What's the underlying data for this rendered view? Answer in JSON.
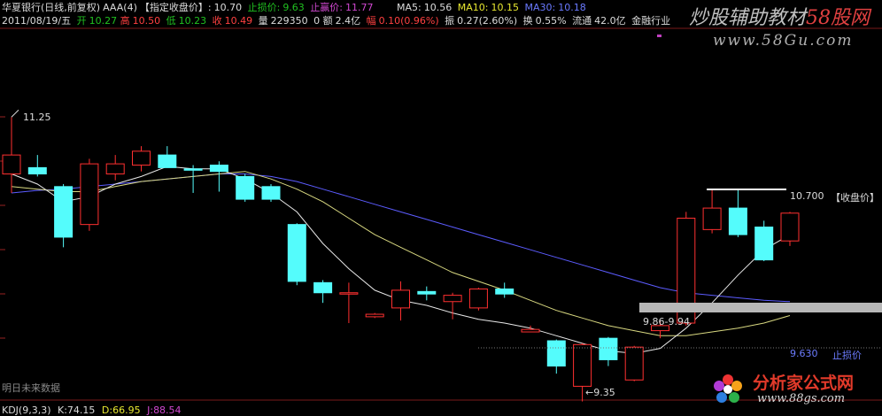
{
  "header": {
    "stock_name": "华夏银行(日线,前复权)",
    "formula": "AAA(4)",
    "close_label": "【指定收盘价】:",
    "close_value": "10.70",
    "stop_loss_label": "止损价:",
    "stop_loss_value": "9.63",
    "stop_profit_label": "止赢价:",
    "stop_profit_value": "11.77",
    "ma5_label": "MA5:",
    "ma5_value": "10.56",
    "ma10_label": "MA10:",
    "ma10_value": "10.15",
    "ma30_label": "MA30:",
    "ma30_value": "10.18"
  },
  "quote": {
    "date": "2011/08/19/五",
    "open_label": "开",
    "open": "10.27",
    "high_label": "高",
    "high": "10.50",
    "low_label": "低",
    "low": "10.23",
    "close_label": "收",
    "close": "10.49",
    "volume_label": "量",
    "volume": "229350",
    "amount_label": "0 额",
    "amount": "2.4亿",
    "change_label": "幅",
    "change": "0.10(0.96%)",
    "amplitude_label": "振",
    "amplitude": "0.27(2.60%)",
    "turnover_label": "换",
    "turnover": "0.55%",
    "float_label": "流通",
    "float_value": "42.0亿",
    "industry": "金融行业"
  },
  "watermark": {
    "top_text": "炒股辅助教材",
    "top_brand": "58股网",
    "top_url": "www.58Gu.com",
    "bottom_text": "分析家公式网",
    "bottom_url": "www.88gs.com"
  },
  "annotations": {
    "high_label": "11.25",
    "low_label": "9.35",
    "range_label": "9.86-9.94",
    "close_line_value": "10.700",
    "close_line_label": "【收盘价】",
    "stop_loss_line_value": "9.630",
    "stop_loss_line_label": "止损价"
  },
  "bottom": {
    "left_caption": "明日未来数据",
    "kdj_label": "KDJ(9,3,3)",
    "k_label": "K:",
    "k_value": "74.15",
    "d_label": "D:",
    "d_value": "66.95",
    "j_label": "J:",
    "j_value": "88.54"
  },
  "colors": {
    "up": "#ff3030",
    "down": "#54fcfc",
    "ma5": "#e8e8e8",
    "ma10": "#d8d880",
    "ma30": "#5c5cff"
  },
  "chart_data": {
    "type": "candlestick",
    "ylim": [
      9.2,
      11.35
    ],
    "candles": [
      {
        "o": 10.8,
        "h": 11.25,
        "l": 10.65,
        "c": 10.95
      },
      {
        "o": 10.85,
        "h": 10.95,
        "l": 10.78,
        "c": 10.8
      },
      {
        "o": 10.7,
        "h": 10.72,
        "l": 10.22,
        "c": 10.3
      },
      {
        "o": 10.4,
        "h": 10.92,
        "l": 10.35,
        "c": 10.88
      },
      {
        "o": 10.8,
        "h": 10.95,
        "l": 10.75,
        "c": 10.88
      },
      {
        "o": 10.87,
        "h": 11.02,
        "l": 10.82,
        "c": 10.98
      },
      {
        "o": 10.95,
        "h": 11.02,
        "l": 10.85,
        "c": 10.85
      },
      {
        "o": 10.84,
        "h": 10.87,
        "l": 10.65,
        "c": 10.83
      },
      {
        "o": 10.87,
        "h": 10.9,
        "l": 10.66,
        "c": 10.82
      },
      {
        "o": 10.78,
        "h": 10.8,
        "l": 10.58,
        "c": 10.6
      },
      {
        "o": 10.7,
        "h": 10.72,
        "l": 10.58,
        "c": 10.6
      },
      {
        "o": 10.4,
        "h": 10.41,
        "l": 9.92,
        "c": 9.95
      },
      {
        "o": 9.94,
        "h": 9.96,
        "l": 9.78,
        "c": 9.86
      },
      {
        "o": 9.85,
        "h": 9.94,
        "l": 9.62,
        "c": 9.86
      },
      {
        "o": 9.67,
        "h": 9.7,
        "l": 9.66,
        "c": 9.69
      },
      {
        "o": 9.74,
        "h": 9.95,
        "l": 9.64,
        "c": 9.88
      },
      {
        "o": 9.87,
        "h": 9.91,
        "l": 9.8,
        "c": 9.85
      },
      {
        "o": 9.79,
        "h": 9.86,
        "l": 9.65,
        "c": 9.84
      },
      {
        "o": 9.74,
        "h": 9.9,
        "l": 9.72,
        "c": 9.89
      },
      {
        "o": 9.89,
        "h": 9.94,
        "l": 9.82,
        "c": 9.85
      },
      {
        "o": 9.55,
        "h": 9.6,
        "l": 9.55,
        "c": 9.57
      },
      {
        "o": 9.48,
        "h": 9.49,
        "l": 9.22,
        "c": 9.28
      },
      {
        "o": 9.12,
        "h": 9.46,
        "l": 9.0,
        "c": 9.45
      },
      {
        "o": 9.5,
        "h": 9.51,
        "l": 9.28,
        "c": 9.33
      },
      {
        "o": 9.17,
        "h": 9.44,
        "l": 9.16,
        "c": 9.43
      },
      {
        "o": 9.56,
        "h": 9.64,
        "l": 9.5,
        "c": 9.6
      },
      {
        "o": 9.62,
        "h": 10.5,
        "l": 9.6,
        "c": 10.45
      },
      {
        "o": 10.36,
        "h": 10.68,
        "l": 10.33,
        "c": 10.53
      },
      {
        "o": 10.53,
        "h": 10.68,
        "l": 10.3,
        "c": 10.32
      },
      {
        "o": 10.38,
        "h": 10.43,
        "l": 10.11,
        "c": 10.12
      },
      {
        "o": 10.27,
        "h": 10.5,
        "l": 10.23,
        "c": 10.49
      }
    ],
    "ma5": [
      10.8,
      10.72,
      10.58,
      10.62,
      10.72,
      10.78,
      10.86,
      10.84,
      10.84,
      10.76,
      10.65,
      10.5,
      10.25,
      10.05,
      9.88,
      9.8,
      9.76,
      9.7,
      9.65,
      9.62,
      9.58,
      9.52,
      9.46,
      9.4,
      9.38,
      9.42,
      9.58,
      9.78,
      10.0,
      10.2,
      10.32
    ],
    "ma10": [
      10.7,
      10.68,
      10.66,
      10.66,
      10.7,
      10.74,
      10.76,
      10.78,
      10.8,
      10.82,
      10.76,
      10.68,
      10.58,
      10.45,
      10.32,
      10.22,
      10.12,
      10.02,
      9.95,
      9.88,
      9.8,
      9.72,
      9.66,
      9.6,
      9.56,
      9.52,
      9.52,
      9.55,
      9.58,
      9.62,
      9.68
    ],
    "ma30": [
      10.65,
      10.67,
      10.68,
      10.7,
      10.72,
      10.74,
      10.76,
      10.78,
      10.8,
      10.8,
      10.78,
      10.74,
      10.68,
      10.62,
      10.56,
      10.5,
      10.44,
      10.38,
      10.32,
      10.26,
      10.2,
      10.14,
      10.08,
      10.02,
      9.96,
      9.9,
      9.86,
      9.84,
      9.82,
      9.8,
      9.79
    ]
  }
}
